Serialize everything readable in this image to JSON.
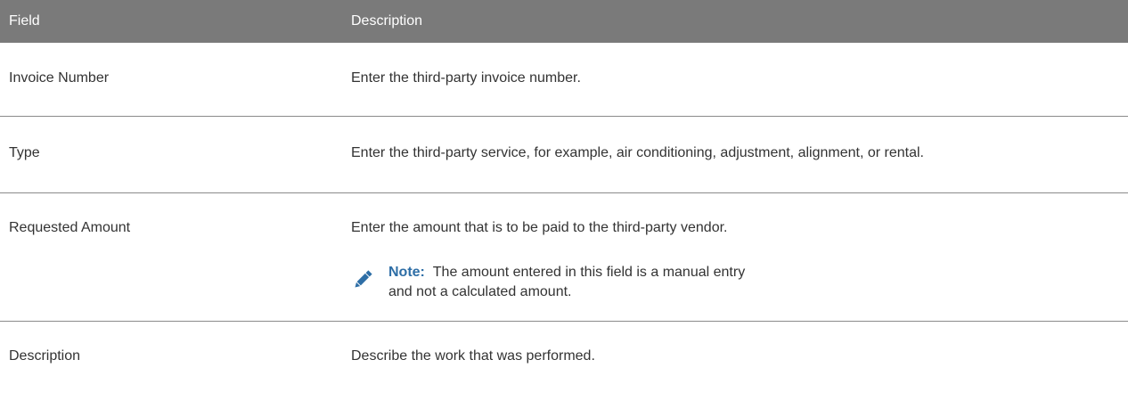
{
  "header": {
    "field_label": "Field",
    "description_label": "Description"
  },
  "rows": [
    {
      "field": "Invoice Number",
      "description": "Enter the third-party invoice number."
    },
    {
      "field": "Type",
      "description": "Enter the third-party service, for example, air conditioning, adjustment, alignment, or rental."
    },
    {
      "field": "Requested Amount",
      "description": "Enter the amount that is to be paid to the third-party vendor.",
      "note_label": "Note:",
      "note_text": "The amount entered in this field is a manual entry and not a calculated amount."
    },
    {
      "field": "Description",
      "description": "Describe the work that was performed."
    }
  ],
  "colors": {
    "header_bg": "#7a7a7a",
    "note_accent": "#2e6ea6"
  },
  "icons": {
    "note": "pencil-icon"
  }
}
